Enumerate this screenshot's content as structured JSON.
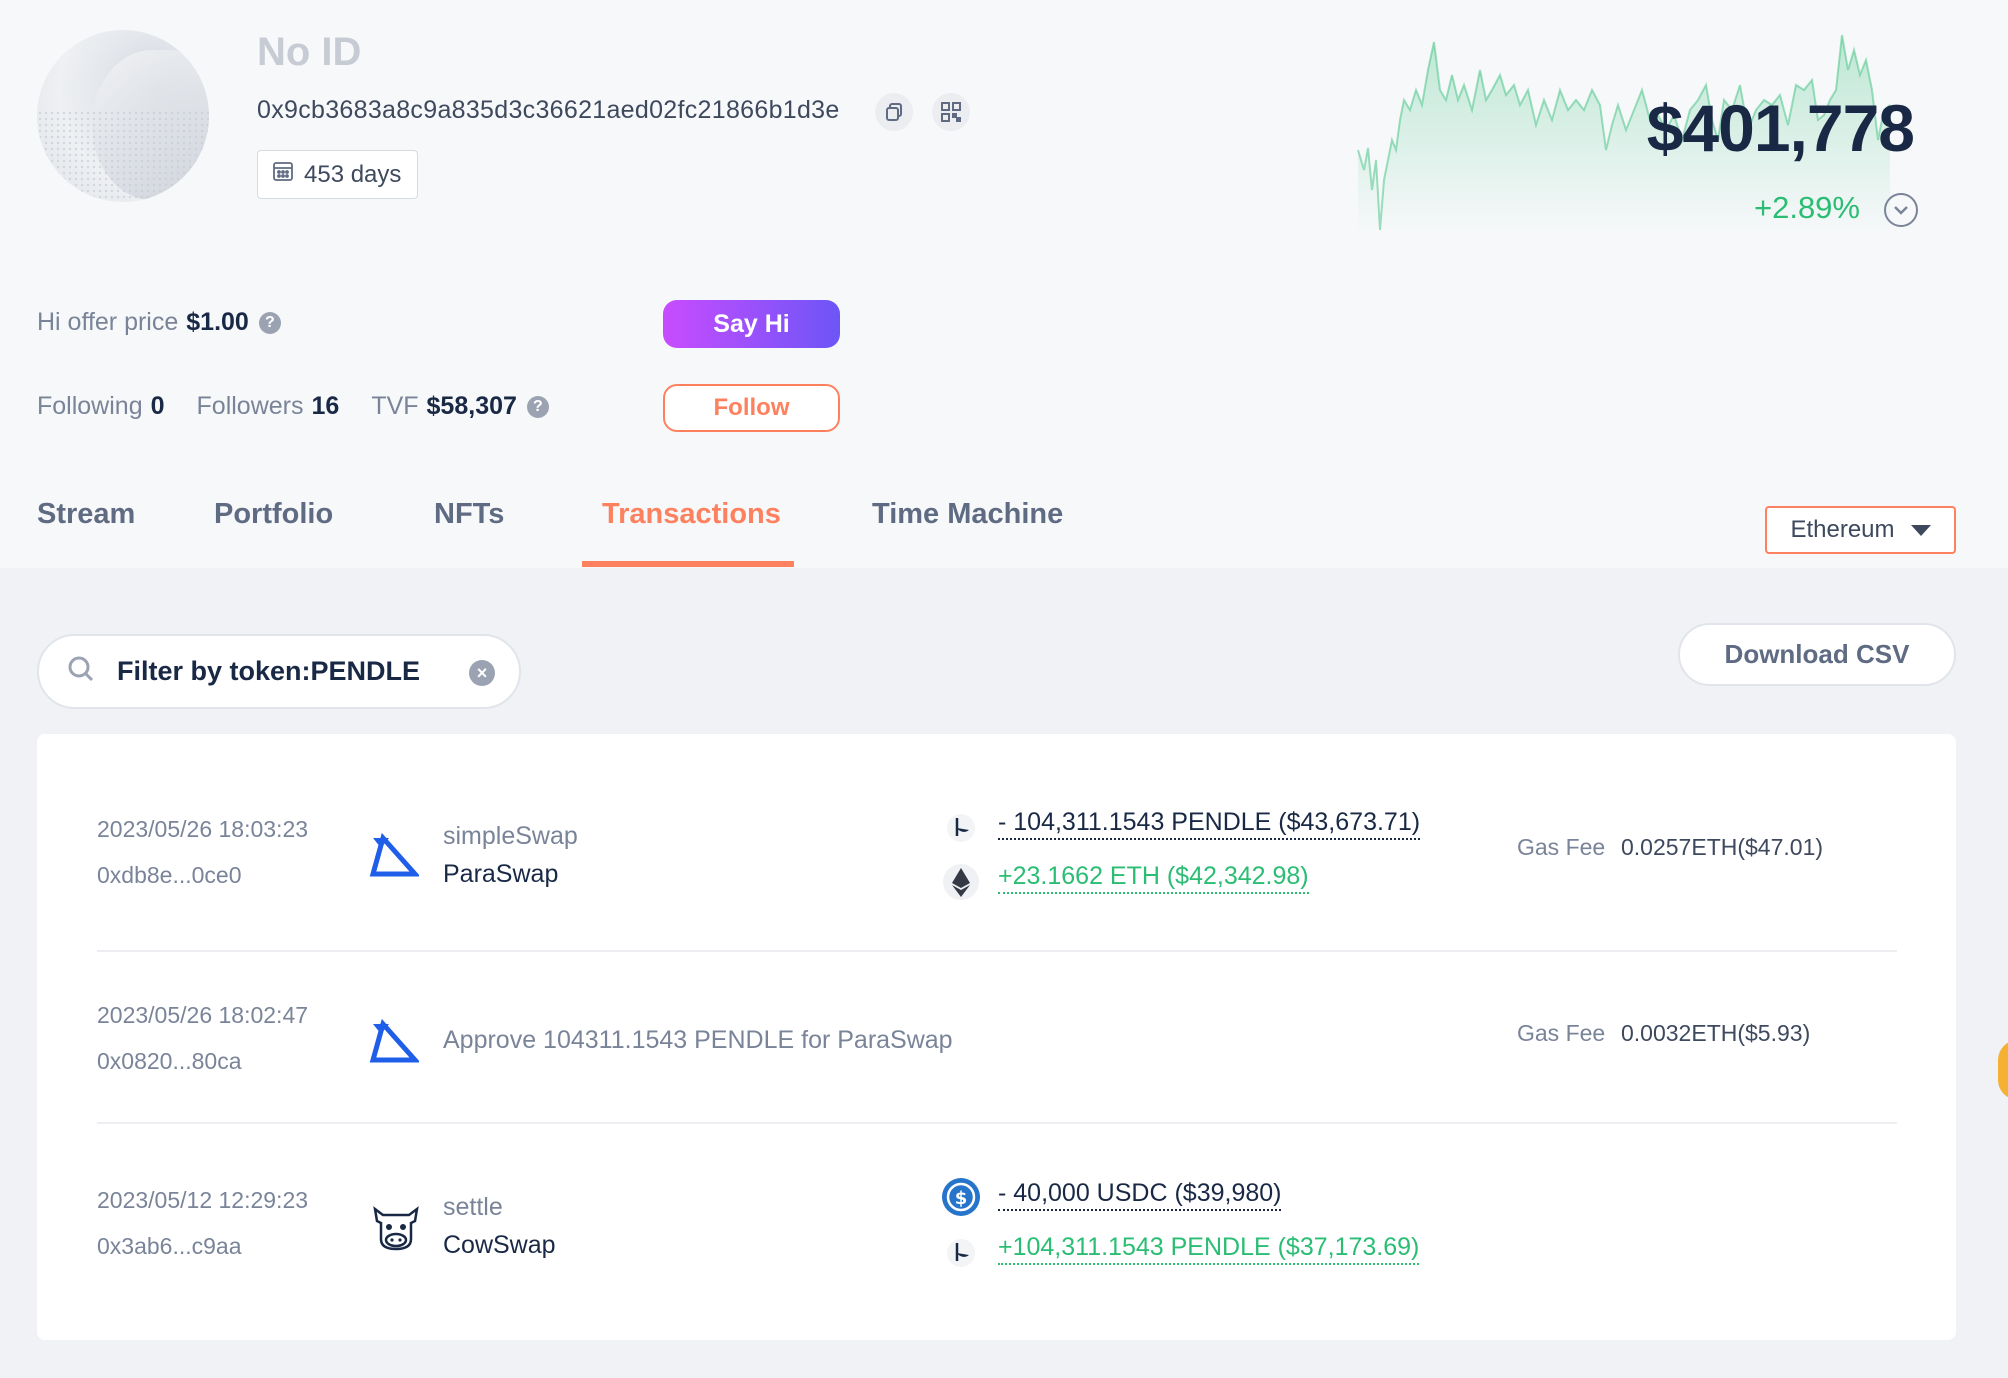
{
  "profile": {
    "name": "No ID",
    "address": "0x9cb3683a8c9a835d3c36621aed02fc21866b1d3e",
    "days": "453 days",
    "balance": "$401,778",
    "change": "+2.89%",
    "hi_offer_label": "Hi offer price",
    "hi_offer_value": "$1.00",
    "following_label": "Following",
    "following_value": "0",
    "followers_label": "Followers",
    "followers_value": "16",
    "tvf_label": "TVF",
    "tvf_value": "$58,307",
    "say_hi": "Say Hi",
    "follow": "Follow",
    "help_glyph": "?"
  },
  "icons": {
    "copy": "copy-icon",
    "qr": "qr-code-icon",
    "calendar": "calendar-icon",
    "search": "search-icon",
    "clear": "clear-icon",
    "caret": "caret-down-icon"
  },
  "colors": {
    "accent": "#fe815f",
    "positive": "#2abd73",
    "text": "#192945",
    "muted": "#7a8499"
  },
  "tabs": [
    {
      "label": "Stream",
      "active": false
    },
    {
      "label": "Portfolio",
      "active": false
    },
    {
      "label": "NFTs",
      "active": false
    },
    {
      "label": "Transactions",
      "active": true
    },
    {
      "label": "Time Machine",
      "active": false
    }
  ],
  "chain": {
    "selected": "Ethereum"
  },
  "filter": {
    "text": "Filter by token:PENDLE",
    "clear_glyph": "×"
  },
  "download_csv": "Download CSV",
  "transactions": [
    {
      "time": "2023/05/26 18:03:23",
      "hash": "0xdb8e...0ce0",
      "method": "simpleSwap",
      "protocol": "ParaSwap",
      "protocol_icon": "paraswap-icon",
      "sends": [
        {
          "token_icon": "pendle-icon",
          "text": "- 104,311.1543 PENDLE ($43,673.71)"
        }
      ],
      "receives": [
        {
          "token_icon": "eth-icon",
          "text": "+23.1662 ETH ($42,342.98)"
        }
      ],
      "gas_label": "Gas Fee",
      "gas": "0.0257ETH($47.01)"
    },
    {
      "time": "2023/05/26 18:02:47",
      "hash": "0x0820...80ca",
      "description": "Approve 104311.1543 PENDLE for ParaSwap",
      "protocol_icon": "paraswap-icon",
      "gas_label": "Gas Fee",
      "gas": "0.0032ETH($5.93)"
    },
    {
      "time": "2023/05/12 12:29:23",
      "hash": "0x3ab6...c9aa",
      "method": "settle",
      "protocol": "CowSwap",
      "protocol_icon": "cowswap-icon",
      "sends": [
        {
          "token_icon": "usdc-icon",
          "text": "- 40,000 USDC ($39,980)"
        }
      ],
      "receives": [
        {
          "token_icon": "pendle-icon",
          "text": "+104,311.1543 PENDLE ($37,173.69)"
        }
      ]
    }
  ]
}
